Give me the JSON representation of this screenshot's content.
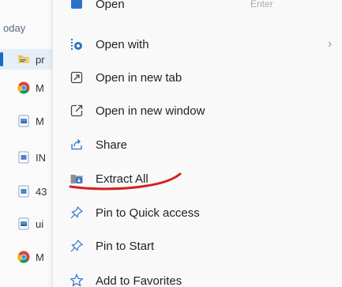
{
  "file_list": {
    "group_label": "oday",
    "rows": [
      {
        "name": "pr",
        "icon": "folder-icon",
        "selected": true
      },
      {
        "name": "M",
        "icon": "chrome-icon",
        "selected": false
      },
      {
        "name": "M",
        "icon": "document-image-icon",
        "selected": false
      },
      {
        "name": "IN",
        "icon": "document-icon",
        "selected": false
      },
      {
        "name": "43",
        "icon": "document-icon",
        "selected": false
      },
      {
        "name": "ui",
        "icon": "document-image-icon",
        "selected": false
      },
      {
        "name": "M",
        "icon": "chrome-icon",
        "selected": false
      }
    ]
  },
  "context_menu": {
    "items": [
      {
        "label": "Open",
        "icon": "open-icon",
        "right_text": "Enter"
      },
      {
        "label": "Open with",
        "icon": "open-with-icon",
        "has_submenu": true
      },
      {
        "label": "Open in new tab",
        "icon": "new-tab-icon"
      },
      {
        "label": "Open in new window",
        "icon": "new-window-icon"
      },
      {
        "label": "Share",
        "icon": "share-icon"
      },
      {
        "label": "Extract All",
        "icon": "extract-all-icon",
        "annotated": true
      },
      {
        "label": "Pin to Quick access",
        "icon": "pin-icon"
      },
      {
        "label": "Pin to Start",
        "icon": "pin-icon"
      },
      {
        "label": "Add to Favorites",
        "icon": "star-icon"
      }
    ],
    "submenu_chevron": "›"
  },
  "colors": {
    "accent": "#1a68c8",
    "annotation_red": "#d61f1f",
    "icon_blue": "#2b73c9"
  }
}
